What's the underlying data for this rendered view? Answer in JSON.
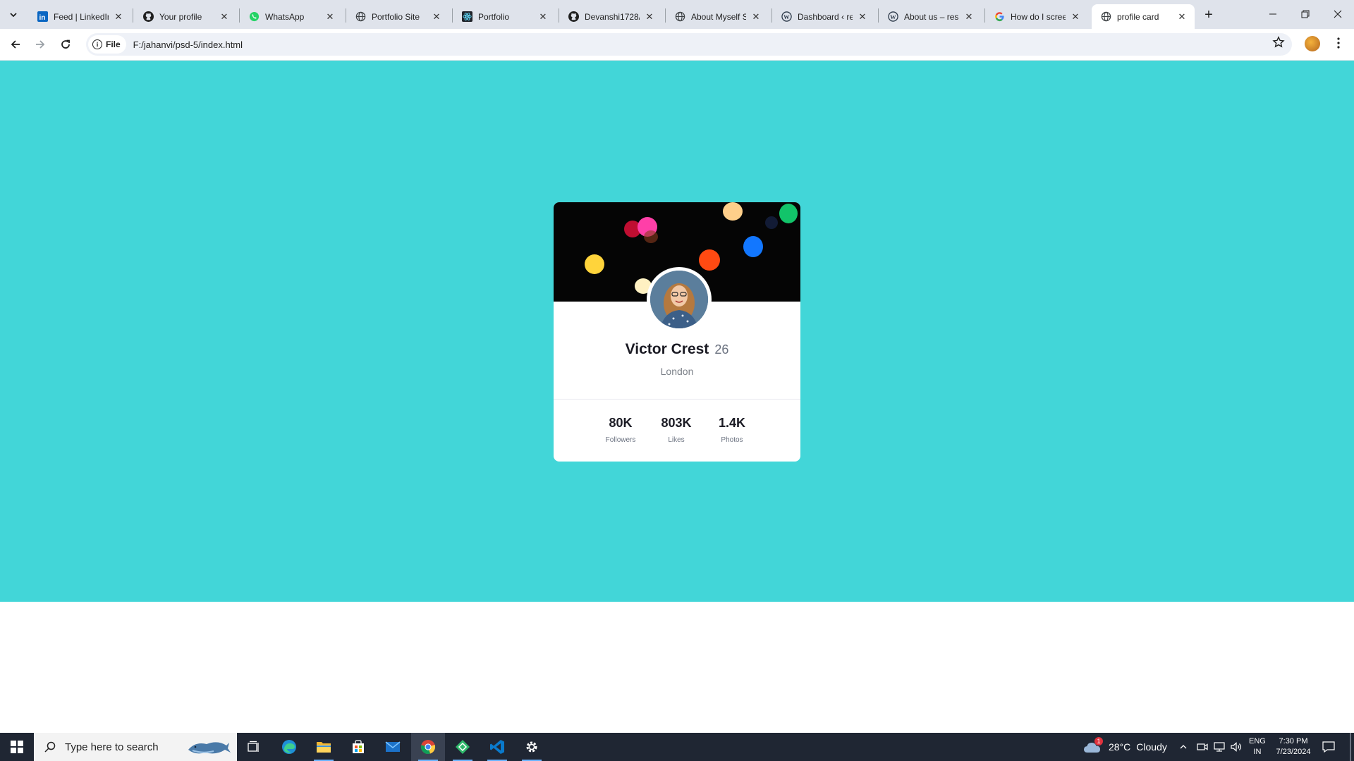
{
  "browser": {
    "tabs": [
      {
        "title": "Feed | LinkedIn",
        "icon": "linkedin-icon"
      },
      {
        "title": "Your profile",
        "icon": "github-icon"
      },
      {
        "title": "WhatsApp",
        "icon": "whatsapp-icon"
      },
      {
        "title": "Portfolio Site",
        "icon": "globe-icon"
      },
      {
        "title": "Portfolio",
        "icon": "react-icon"
      },
      {
        "title": "Devanshi1728/",
        "icon": "github-icon"
      },
      {
        "title": "About Myself S",
        "icon": "globe-icon"
      },
      {
        "title": "Dashboard ‹ re",
        "icon": "wordpress-icon"
      },
      {
        "title": "About us – resi",
        "icon": "wordpress-icon"
      },
      {
        "title": "How do I scree",
        "icon": "google-icon"
      },
      {
        "title": "profile card",
        "icon": "globe-icon",
        "active": true
      }
    ],
    "tab_close_glyph": "✕",
    "new_tab_glyph": "+",
    "address": {
      "chip_label": "File",
      "url": "F:/jahanvi/psd-5/index.html"
    }
  },
  "page": {
    "background_color": "#42d6d8",
    "card": {
      "name": "Victor Crest",
      "age": "26",
      "city": "London",
      "stats": [
        {
          "value": "80K",
          "label": "Followers"
        },
        {
          "value": "803K",
          "label": "Likes"
        },
        {
          "value": "1.4K",
          "label": "Photos"
        }
      ]
    }
  },
  "taskbar": {
    "search_placeholder": "Type here to search",
    "apps": [
      "task-view-icon",
      "edge-icon",
      "file-explorer-icon",
      "microsoft-store-icon",
      "mail-icon",
      "chrome-icon",
      "git-app-icon",
      "vscode-icon",
      "settings-icon"
    ],
    "weather": {
      "temp": "28°C",
      "condition": "Cloudy",
      "alert_count": "1"
    },
    "language": {
      "lang": "ENG",
      "region": "IN"
    },
    "clock": {
      "time": "7:30 PM",
      "date": "7/23/2024"
    }
  }
}
